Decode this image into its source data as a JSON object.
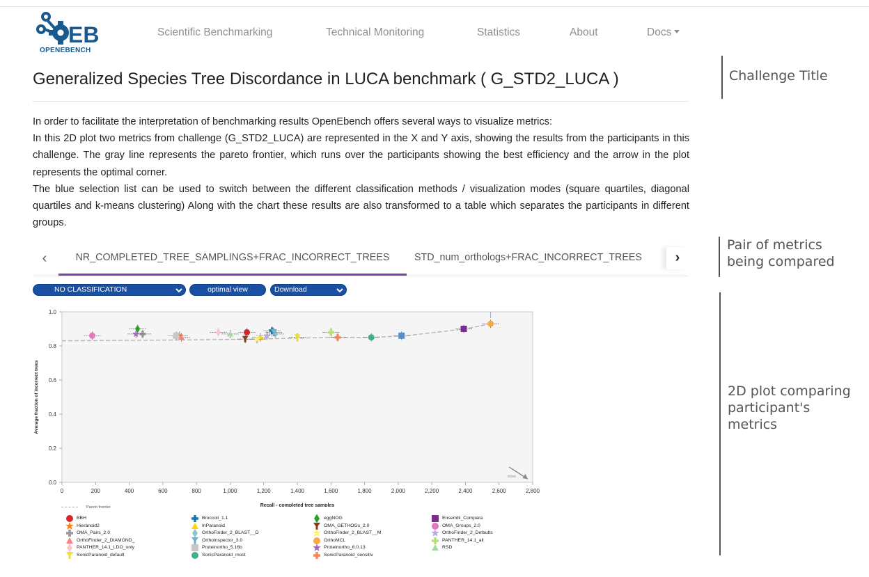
{
  "logo": {
    "text": "OPENEBENCH",
    "brand_color": "#1a5a8f"
  },
  "nav": {
    "items": [
      "Scientific Benchmarking",
      "Technical Monitoring",
      "Statistics",
      "About",
      "Docs"
    ]
  },
  "title": "Generalized Species Tree Discordance in LUCA benchmark ( G_STD2_LUCA )",
  "description": [
    "In order to facilitate the interpretation of benchmarking results OpenEbench offers several ways to visualize metrics:",
    "In this 2D plot two metrics from challenge (G_STD2_LUCA) are represented in the X and Y axis, showing the results from the participants in this challenge. The gray line represents the pareto frontier, which runs over the participants showing the best efficiency and the arrow in the plot represents the optimal corner.",
    "The blue selection list can be used to switch between the different classification methods / visualization modes (square quartiles, diagonal quartiles and k-means clustering) Along with the chart these results are also transformed to a table which separates the participants in different groups."
  ],
  "tabs": {
    "prev_icon": "chevron-left-icon",
    "next_icon": "chevron-right-icon",
    "items": [
      "NR_COMPLETED_TREE_SAMPLINGS+FRAC_INCORRECT_TREES",
      "STD_num_orthologs+FRAC_INCORRECT_TREES"
    ],
    "active_color": "#7b3fa8"
  },
  "controls": {
    "classification": "NO CLASSIFICATION",
    "optimal_view": "optimal view",
    "download": "Download",
    "button_color": "#1a4fa1"
  },
  "annotations": {
    "challenge_title": "Challenge Title",
    "pair_of_metrics": "Pair of metrics being compared",
    "plot_comparing": "2D plot comparing participant's metrics"
  },
  "chart_data": {
    "type": "scatter",
    "xlabel": "Recall - completed tree samples",
    "ylabel": "Average fraction of incorrect trees",
    "xlim": [
      0,
      2800
    ],
    "ylim": [
      0,
      1.0
    ],
    "xticks": [
      0,
      200,
      400,
      600,
      800,
      1000,
      1200,
      1400,
      1600,
      1800,
      2000,
      2200,
      2400,
      2600,
      2800
    ],
    "xtick_labels": [
      "0",
      "200",
      "400",
      "600",
      "800",
      "1,000",
      "1,200",
      "1,400",
      "1,600",
      "1,800",
      "2,000",
      "2,200",
      "2,400",
      "2,600",
      "2,800"
    ],
    "yticks": [
      0,
      0.2,
      0.4,
      0.6,
      0.8,
      1.0
    ],
    "ytick_labels": [
      "0.0",
      "0.2",
      "0.4",
      "0.6",
      "0.8",
      "1.0"
    ],
    "grid": false,
    "legend_placement": "bottom",
    "pareto_label": "Pareto frontier",
    "pareto_frontier": [
      [
        0,
        0.83
      ],
      [
        700,
        0.835
      ],
      [
        1150,
        0.84
      ],
      [
        1600,
        0.85
      ],
      [
        1850,
        0.85
      ],
      [
        2050,
        0.86
      ],
      [
        2400,
        0.9
      ],
      [
        2550,
        0.93
      ]
    ],
    "series": [
      {
        "name": "BBH",
        "x": 1100,
        "y": 0.88,
        "color": "#d62728",
        "shape": "circle"
      },
      {
        "name": "Broccoli_1.1",
        "x": 1250,
        "y": 0.89,
        "color": "#1f77b4",
        "shape": "cross"
      },
      {
        "name": "eggNOG",
        "x": 450,
        "y": 0.9,
        "color": "#2ca02c",
        "shape": "diamond"
      },
      {
        "name": "Ensembl_Compara",
        "x": 2390,
        "y": 0.9,
        "color": "#7b2d8e",
        "shape": "square"
      },
      {
        "name": "Hieranoid2",
        "x": 700,
        "y": 0.86,
        "color": "#ff7f0e",
        "shape": "star"
      },
      {
        "name": "InParanoid",
        "x": 1180,
        "y": 0.85,
        "color": "#ffd700",
        "shape": "triangle"
      },
      {
        "name": "OMA_GETHOGs_2.0",
        "x": 1090,
        "y": 0.84,
        "color": "#8c3a1a",
        "shape": "tri-down"
      },
      {
        "name": "OMA_Groups_2.0",
        "x": 180,
        "y": 0.86,
        "color": "#e377c2",
        "shape": "circle"
      },
      {
        "name": "OMA_Pairs_2.0",
        "x": 480,
        "y": 0.87,
        "color": "#999999",
        "shape": "cross"
      },
      {
        "name": "OrthoFinder_2_BLAST__D",
        "x": 1270,
        "y": 0.87,
        "color": "#8fc6c9",
        "shape": "diamond"
      },
      {
        "name": "OrthoFinder_2_BLAST__M",
        "x": 1160,
        "y": 0.84,
        "color": "#fff176",
        "shape": "star"
      },
      {
        "name": "OrthoFinder_2_Defaults",
        "x": 1220,
        "y": 0.86,
        "color": "#b8a9e0",
        "shape": "star"
      },
      {
        "name": "OrthoFinder_2_DIAMOND_",
        "x": 710,
        "y": 0.85,
        "color": "#ff7f7f",
        "shape": "triangle"
      },
      {
        "name": "OrthoInspector_3.0",
        "x": 1260,
        "y": 0.88,
        "color": "#6fb2c9",
        "shape": "tri-down"
      },
      {
        "name": "OrthoMCL",
        "x": 2550,
        "y": 0.93,
        "color": "#f7a94a",
        "shape": "circle"
      },
      {
        "name": "PANTHER_14.1_all",
        "x": 1600,
        "y": 0.88,
        "color": "#b5e07b",
        "shape": "cross"
      },
      {
        "name": "PANTHER_14.1_LDO_only",
        "x": 930,
        "y": 0.88,
        "color": "#f7c6cf",
        "shape": "diamond"
      },
      {
        "name": "Proteinortho_5.16b",
        "x": 680,
        "y": 0.86,
        "color": "#c7c7c7",
        "shape": "square"
      },
      {
        "name": "Proteinortho_6.0.13",
        "x": 440,
        "y": 0.87,
        "color": "#a566c8",
        "shape": "star"
      },
      {
        "name": "RSD",
        "x": 1000,
        "y": 0.87,
        "color": "#a6dba0",
        "shape": "triangle"
      },
      {
        "name": "SonicParanoid_default",
        "x": 1400,
        "y": 0.85,
        "color": "#f0e130",
        "shape": "tri-down"
      },
      {
        "name": "SonicParanoid_most",
        "x": 1840,
        "y": 0.85,
        "color": "#3fb08a",
        "shape": "circle"
      },
      {
        "name": "SonicParanoid_sensitiv",
        "x": 1640,
        "y": 0.85,
        "color": "#f5865a",
        "shape": "cross"
      },
      {
        "name": "",
        "x": 2020,
        "y": 0.86,
        "color": "#5b8fc9",
        "shape": "square"
      }
    ]
  }
}
